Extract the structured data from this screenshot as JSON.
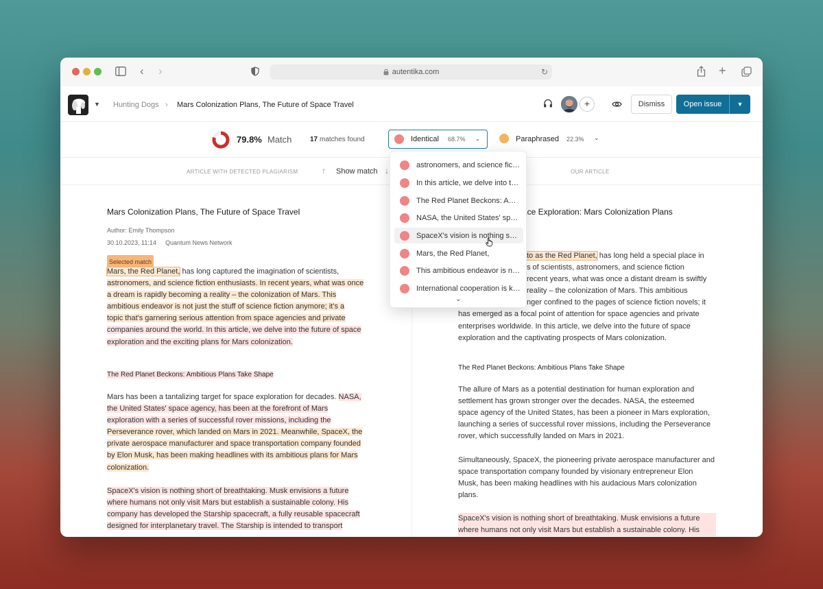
{
  "browser": {
    "url": "autentika.com"
  },
  "header": {
    "breadcrumb_parent": "Hunting Dogs",
    "breadcrumb_current": "Mars Colonization Plans, The Future of Space Travel",
    "dismiss_label": "Dismiss",
    "open_issue_label": "Open issue"
  },
  "stats": {
    "match_percent": "79.8%",
    "match_label": "Match",
    "match_fraction": 0.798,
    "matches_count": "17",
    "matches_label": "matches found",
    "identical_label": "Identical",
    "identical_percent": "68.7%",
    "paraphrased_label": "Paraphrased",
    "paraphrased_percent": "22.3%",
    "colors": {
      "identical": "#ef8584",
      "paraphrased": "#f6b25f",
      "ring": "#c9302c",
      "accent": "#0f6f97"
    }
  },
  "columns": {
    "left_header": "ARTICLE WITH DETECTED PLAGIARISM",
    "show_match": "Show match",
    "right_header": "OUR ARTICLE"
  },
  "dropdown": {
    "items": [
      "astronomers, and science fiction enthusiasts.",
      "In this article, we delve into the future",
      "The Red Planet Beckons: Ambitious Plans",
      "NASA, the United States' space agency",
      "SpaceX's vision is nothing short of breathtaking.",
      "Mars, the Red Planet,",
      "This ambitious endeavor is not just",
      "International cooperation is key"
    ]
  },
  "left_article": {
    "title": "Mars Colonization Plans, The Future of Space Travel",
    "author": "Author: Emily Thompson",
    "date": "30.10.2023, 11:14",
    "source": "Quantum News Network",
    "selected_badge": "Selected match",
    "p1_selected": "Mars, the Red Planet,",
    "p1_rest_line1": "has long captured the imagination of scientists,",
    "p1_lines": [
      "astronomers, and science fiction enthusiasts. In recent years, what was once",
      "a dream is rapidly becoming a reality – the colonization of Mars. This",
      "ambitious endeavor is not just the stuff of science fiction anymore; it's a",
      "topic that's garnering serious attention from space agencies and private",
      "companies around the world. In this article, we delve into the future of space",
      "exploration and the exciting plans for Mars colonization."
    ],
    "subheading": "The Red Planet Beckons: Ambitious Plans Take Shape",
    "p2_line1_plain": "Mars has been a tantalizing target for space exploration for decades.",
    "p2_line1_hl": "NASA,",
    "p2_lines": [
      "the United States' space agency, has been at the forefront of Mars",
      "exploration with a series of successful rover missions, including the",
      "Perseverance rover, which landed on Mars in 2021. Meanwhile, SpaceX, the",
      "private aerospace manufacturer and space transportation company founded",
      "by Elon Musk, has been making headlines with its ambitious plans for Mars",
      "colonization."
    ],
    "p3_lines": [
      "SpaceX's vision is nothing short of breathtaking. Musk envisions a future",
      "where humans not only visit Mars but establish a sustainable colony. His",
      "company has developed the Starship spacecraft, a fully reusable spacecraft",
      "designed for interplanetary travel. The Starship is intended to transport"
    ]
  },
  "right_article": {
    "title_fragment": "ace Exploration: Mars Colonization Plans",
    "p1_line1_hl": "to as the Red Planet,",
    "p1_line1_rest": "has long held a special place in",
    "p1_lines": [
      "s of scientists, astronomers, and science fiction",
      "recent years, what was once a distant dream is swiftly",
      "reality – the colonization of Mars. This ambitious",
      "nger confined to the pages of science fiction novels; it",
      "has emerged as a focal point of attention for space agencies and private",
      "enterprises worldwide. In this article, we delve into the future of space",
      "exploration and the captivating prospects of Mars colonization."
    ],
    "subheading": "The Red Planet Beckons: Ambitious Plans Take Shape",
    "p2_lines": [
      "The allure of Mars as a potential destination for human exploration and",
      "settlement has grown stronger over the decades. NASA, the esteemed",
      "space agency of the United States, has been a pioneer in Mars exploration,",
      "launching a series of successful rover missions, including the Perseverance",
      "rover, which successfully landed on Mars in 2021."
    ],
    "p3_lines": [
      "Simultaneously, SpaceX, the pioneering private aerospace manufacturer and",
      "space transportation company founded by visionary entrepreneur Elon",
      "Musk, has been making headlines with his audacious Mars colonization",
      "plans."
    ],
    "p4_lines": [
      "SpaceX's vision is nothing short of breathtaking. Musk envisions a future",
      "where humans not only visit Mars but establish a sustainable colony. His"
    ]
  }
}
